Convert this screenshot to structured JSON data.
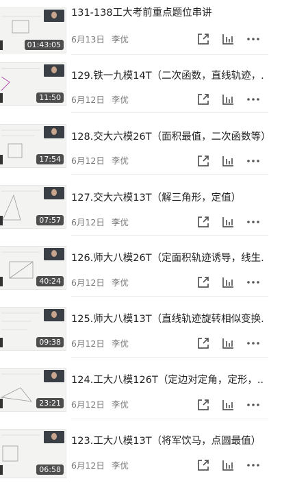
{
  "author": "李优",
  "items": [
    {
      "title": "131-138工大考前重点题位串讲",
      "date": "6月13日",
      "duration": "01:43:05"
    },
    {
      "title": "129.铁一九模14T（二次函数，直线轨迹，...",
      "date": "6月12日",
      "duration": "11:50"
    },
    {
      "title": "128.交大六模26T（面积最值，二次函数等）",
      "date": "6月12日",
      "duration": "17:54"
    },
    {
      "title": "127.交大六模13T（解三角形，定值）",
      "date": "6月12日",
      "duration": "07:57"
    },
    {
      "title": "126.师大八模26T（定面积轨迹诱导，线生...",
      "date": "6月12日",
      "duration": "40:24"
    },
    {
      "title": "125.师大八模13T（直线轨迹旋转相似变换...",
      "date": "6月12日",
      "duration": "09:38"
    },
    {
      "title": "124.工大八模126T（定边对定角，定形，...",
      "date": "6月12日",
      "duration": "23:21"
    },
    {
      "title": "123.工大八模13T（将军饮马，点圆最值）",
      "date": "6月12日",
      "duration": "06:58"
    }
  ],
  "icons": {
    "share": "share-icon",
    "stats": "stats-icon",
    "more": "more-icon"
  },
  "colors": {
    "icon": "#555555",
    "duration_bg": "#333333"
  }
}
